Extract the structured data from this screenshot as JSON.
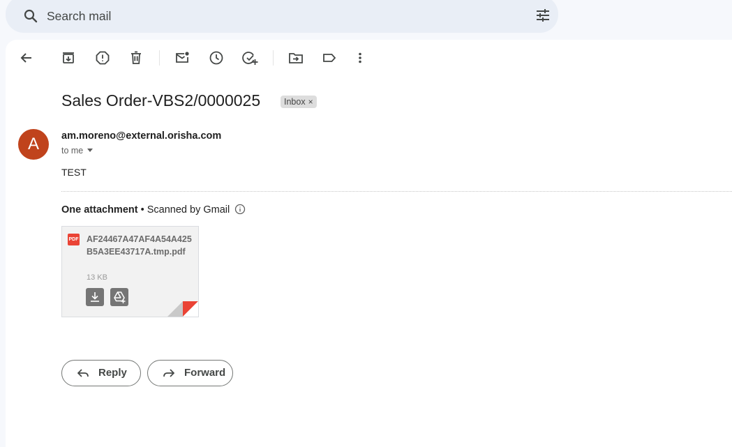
{
  "search": {
    "placeholder": "Search mail"
  },
  "toolbar": {
    "icons": [
      "back-arrow-icon",
      "archive-icon",
      "report-spam-icon",
      "delete-icon",
      "mark-unread-icon",
      "snooze-icon",
      "add-to-tasks-icon",
      "move-to-icon",
      "label-icon",
      "more-options-icon"
    ]
  },
  "email": {
    "subject": "Sales Order-VBS2/0000025",
    "label_chip": "Inbox",
    "label_chip_close": "×",
    "avatar_letter": "A",
    "avatar_color": "#c0431c",
    "sender": "am.moreno@external.orisha.com",
    "recipient": "to me",
    "body": "TEST"
  },
  "attachments": {
    "heading": "One attachment",
    "scan_note": "• Scanned by Gmail",
    "items": [
      {
        "type_badge": "PDF",
        "file_name": "AF24467A47AF4A54A425B5A3EE43717A.tmp.pdf",
        "size": "13 KB"
      }
    ]
  },
  "actions": {
    "reply": "Reply",
    "forward": "Forward"
  },
  "colors": {
    "accent_red": "#ea4335",
    "page_bg": "#f6f8fc",
    "search_bg": "#e9eef6"
  }
}
